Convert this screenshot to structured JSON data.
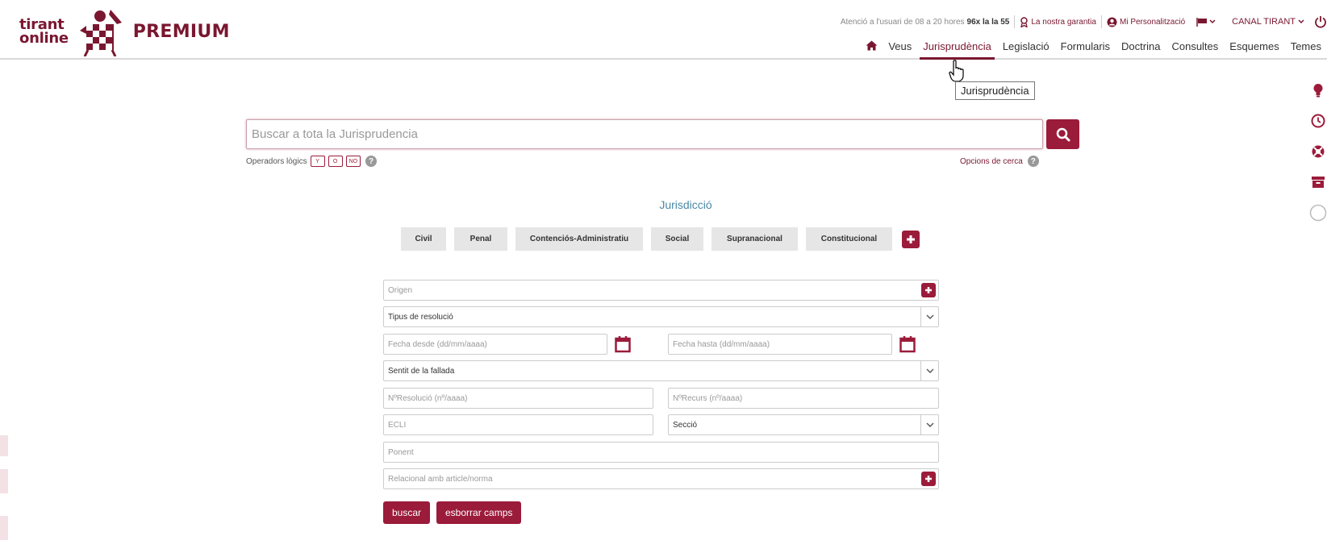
{
  "brand": {
    "logo_line1": "tirant",
    "logo_line2": "online",
    "premium": "PREMIUM",
    "color": "#7a1730"
  },
  "topbar": {
    "hours": "Atenció a l'usuari de 08 a 20 hores",
    "phone": "96x la la 55",
    "guarantee": "La nostra garantia",
    "personalization": "Mi Personalització",
    "canal": "CANAL TIRANT"
  },
  "nav": {
    "items": [
      {
        "label": "Veus"
      },
      {
        "label": "Jurisprudència"
      },
      {
        "label": "Legislació"
      },
      {
        "label": "Formularis"
      },
      {
        "label": "Doctrina"
      },
      {
        "label": "Consultes"
      },
      {
        "label": "Esquemes"
      },
      {
        "label": "Temes"
      }
    ],
    "active": "Jurisprudència"
  },
  "tooltip": "Jurisprudència",
  "search": {
    "placeholder": "Buscar a tota la Jurisprudencia",
    "logic_label": "Operadors lògics",
    "ops": [
      "Y",
      "O",
      "NO"
    ],
    "options_label": "Opcions de cerca",
    "help": "?"
  },
  "jurisdiction": {
    "title": "Jurisdicció",
    "items": [
      "Civil",
      "Penal",
      "Contenciós-Administratiu",
      "Social",
      "Supranacional",
      "Constitucional"
    ]
  },
  "form": {
    "origen": "Origen",
    "tipus": "Tipus de resolució",
    "fecha_desde": "Fecha desde (dd/mm/aaaa)",
    "fecha_hasta": "Fecha hasta (dd/mm/aaaa)",
    "sentit": "Sentit de la fallada",
    "n_resolucio": "NºResolució (nº/aaaa)",
    "n_recurs": "NºRecurs (nº/aaaa)",
    "ecli": "ECLI",
    "seccio": "Secció",
    "ponent": "Ponent",
    "relacional": "Relacional amb article/norma"
  },
  "buttons": {
    "search": "buscar",
    "clear": "esborrar camps"
  },
  "colors": {
    "accent": "#9b1b3a",
    "link": "#4a89a6"
  }
}
